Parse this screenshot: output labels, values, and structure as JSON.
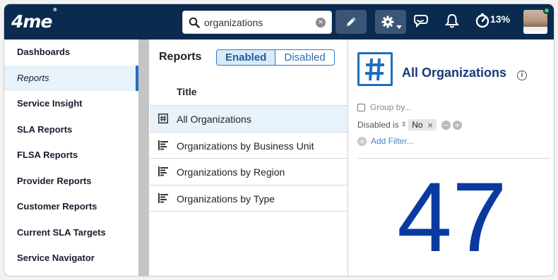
{
  "app": {
    "logo": "4me",
    "logo_mark": "®"
  },
  "search": {
    "value": "organizations",
    "clear_glyph": "×"
  },
  "header": {
    "usage_percent": "13%"
  },
  "sidebar": {
    "items": [
      {
        "label": "Dashboards"
      },
      {
        "label": "Reports"
      },
      {
        "label": "Service Insight"
      },
      {
        "label": "SLA Reports"
      },
      {
        "label": "FLSA Reports"
      },
      {
        "label": "Provider Reports"
      },
      {
        "label": "Customer Reports"
      },
      {
        "label": "Current SLA Targets"
      },
      {
        "label": "Service Navigator"
      }
    ],
    "active_index": 1
  },
  "reports": {
    "title": "Reports",
    "toggle": {
      "enabled": "Enabled",
      "disabled": "Disabled",
      "selected": "Enabled"
    },
    "column_title": "Title",
    "rows": [
      {
        "icon": "hash-icon",
        "label": "All Organizations",
        "selected": true
      },
      {
        "icon": "bar-list-icon",
        "label": "Organizations by Business Unit"
      },
      {
        "icon": "bar-list-icon",
        "label": "Organizations by Region"
      },
      {
        "icon": "bar-list-icon",
        "label": "Organizations by Type"
      }
    ]
  },
  "detail": {
    "icon": "hash-icon",
    "title": "All Organizations",
    "info_glyph": "i",
    "group_by": "Group by...",
    "filter": {
      "field": "Disabled",
      "operator": "is",
      "value": "No"
    },
    "add_filter": "Add Filter...",
    "count": "47"
  },
  "colors": {
    "topbar": "#0a2a50",
    "accent": "#1f6fbf",
    "count": "#0a3aa0"
  }
}
